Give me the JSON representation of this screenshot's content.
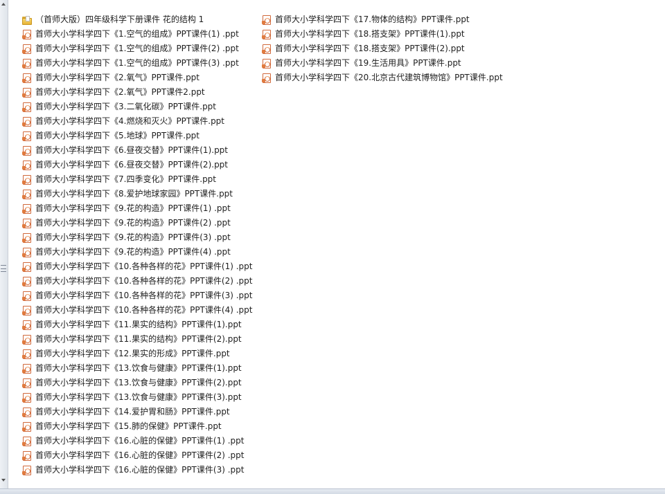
{
  "toolbar": {
    "items": [
      "",
      "",
      ""
    ]
  },
  "folder": {
    "name": "（首师大版）四年级科学下册课件 花的结构 1",
    "icon": "folder-icon"
  },
  "files_left": [
    "首师大小学科学四下《1.空气的组成》PPT课件(1) .ppt",
    "首师大小学科学四下《1.空气的组成》PPT课件(2) .ppt",
    "首师大小学科学四下《1.空气的组成》PPT课件(3) .ppt",
    "首师大小学科学四下《2.氧气》PPT课件.ppt",
    "首师大小学科学四下《2.氧气》PPT课件2.ppt",
    "首师大小学科学四下《3.二氧化碳》PPT课件.ppt",
    "首师大小学科学四下《4.燃烧和灭火》PPT课件.ppt",
    "首师大小学科学四下《5.地球》PPT课件.ppt",
    "首师大小学科学四下《6.昼夜交替》PPT课件(1).ppt",
    "首师大小学科学四下《6.昼夜交替》PPT课件(2).ppt",
    "首师大小学科学四下《7.四季变化》PPT课件.ppt",
    "首师大小学科学四下《8.爱护地球家园》PPT课件.ppt",
    "首师大小学科学四下《9.花的构造》PPT课件(1) .ppt",
    "首师大小学科学四下《9.花的构造》PPT课件(2) .ppt",
    "首师大小学科学四下《9.花的构造》PPT课件(3) .ppt",
    "首师大小学科学四下《9.花的构造》PPT课件(4) .ppt",
    "首师大小学科学四下《10.各种各样的花》PPT课件(1) .ppt",
    "首师大小学科学四下《10.各种各样的花》PPT课件(2) .ppt",
    "首师大小学科学四下《10.各种各样的花》PPT课件(3) .ppt",
    "首师大小学科学四下《10.各种各样的花》PPT课件(4) .ppt",
    "首师大小学科学四下《11.果实的结构》PPT课件(1).ppt",
    "首师大小学科学四下《11.果实的结构》PPT课件(2).ppt",
    "首师大小学科学四下《12.果实的形成》PPT课件.ppt",
    "首师大小学科学四下《13.饮食与健康》PPT课件(1).ppt",
    "首师大小学科学四下《13.饮食与健康》PPT课件(2).ppt",
    "首师大小学科学四下《13.饮食与健康》PPT课件(3).ppt",
    "首师大小学科学四下《14.爱护胃和肠》PPT课件.ppt",
    "首师大小学科学四下《15.肺的保健》PPT课件.ppt",
    "首师大小学科学四下《16.心脏的保健》PPT课件(1) .ppt",
    "首师大小学科学四下《16.心脏的保健》PPT课件(2) .ppt",
    "首师大小学科学四下《16.心脏的保健》PPT课件(3) .ppt"
  ],
  "files_right": [
    "首师大小学科学四下《17.物体的结构》PPT课件.ppt",
    "首师大小学科学四下《18.搭支架》PPT课件(1).ppt",
    "首师大小学科学四下《18.搭支架》PPT课件(2).ppt",
    "首师大小学科学四下《19.生活用具》PPT课件.ppt",
    "首师大小学科学四下《20.北京古代建筑博物馆》PPT课件.ppt"
  ],
  "file_icon": "ppt-file-icon",
  "colors": {
    "ppt_accent": "#d0683a",
    "folder_yellow": "#f8d66a",
    "text": "#1e1e1e"
  }
}
